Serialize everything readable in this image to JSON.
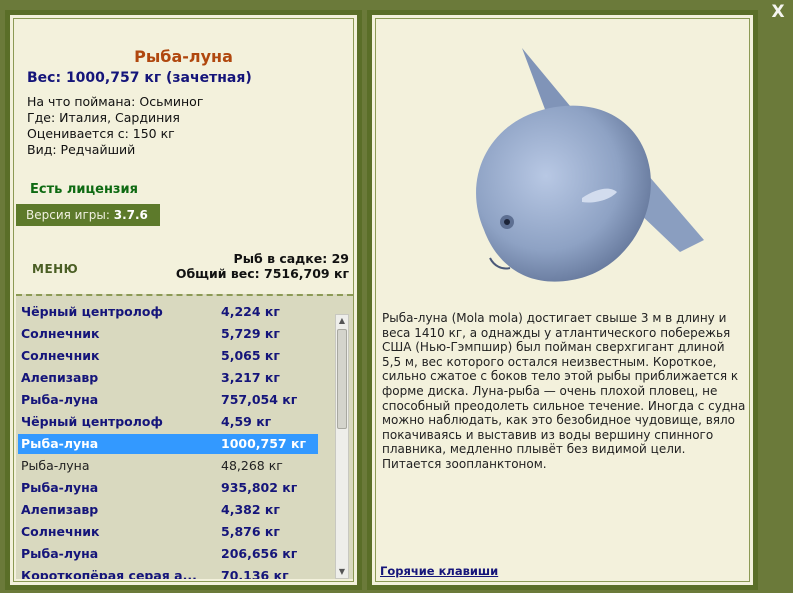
{
  "fish": {
    "title": "Рыба-луна",
    "weight_line": "Вес: 1000,757 кг (зачетная)",
    "caught_on": "На что поймана: Осьминог",
    "where": "Где: Италия, Сардиния",
    "rated_from": "Оценивается с: 150 кг",
    "kind": "Вид: Редчайший"
  },
  "license": "Есть лицензия",
  "version": {
    "label": "Версия игры:",
    "value": "3.7.6"
  },
  "menu_label": "МЕНЮ",
  "stats": {
    "in_cage": "Рыб в садке: 29",
    "total_weight": "Общий вес: 7516,709 кг"
  },
  "catch_list": [
    {
      "name": "Чёрный центролоф",
      "weight": "4,224 кг",
      "style": "bold"
    },
    {
      "name": "Солнечник",
      "weight": "5,729 кг",
      "style": "bold"
    },
    {
      "name": "Солнечник",
      "weight": "5,065 кг",
      "style": "bold"
    },
    {
      "name": "Алепизавр",
      "weight": "3,217 кг",
      "style": "bold"
    },
    {
      "name": "Рыба-луна",
      "weight": "757,054 кг",
      "style": "bold"
    },
    {
      "name": "Чёрный центролоф",
      "weight": "4,59 кг",
      "style": "bold"
    },
    {
      "name": "Рыба-луна",
      "weight": "1000,757 кг",
      "style": "sel"
    },
    {
      "name": "Рыба-луна",
      "weight": "48,268 кг",
      "style": "plain"
    },
    {
      "name": "Рыба-луна",
      "weight": "935,802 кг",
      "style": "bold"
    },
    {
      "name": "Алепизавр",
      "weight": "4,382 кг",
      "style": "bold"
    },
    {
      "name": "Солнечник",
      "weight": "5,876 кг",
      "style": "bold"
    },
    {
      "name": "Рыба-луна",
      "weight": "206,656 кг",
      "style": "bold"
    },
    {
      "name": "Короткопёрая серая а...",
      "weight": "70,136 кг",
      "style": "bold"
    }
  ],
  "scroll": {
    "up_icon": "▲",
    "down_icon": "▼"
  },
  "description": "Рыба-луна (Mola mola) достигает свыше 3 м в длину и веса 1410 кг, а однажды у атлантического побережья США (Нью-Гэмпшир) был пойман сверхгигант длиной 5,5 м, вес которого остался неизвестным. Короткое, сильно сжатое с боков тело этой рыбы приближается к форме диска. Луна-рыба — очень плохой пловец, не способный преодолеть сильное течение. Иногда с судна можно наблюдать, как это безобидное чудовище, вяло покачиваясь и выставив из воды вершину спинного плавника, медленно плывёт без видимой цели. Питается зоопланктоном.",
  "hotkeys_label": "Горячие клавиши",
  "close_label": "X",
  "colors": {
    "frame": "#5a6e28",
    "panel": "#f3f1dc",
    "selection": "#3399ff",
    "name_blue": "#15157a",
    "title_orange": "#b0470e"
  }
}
